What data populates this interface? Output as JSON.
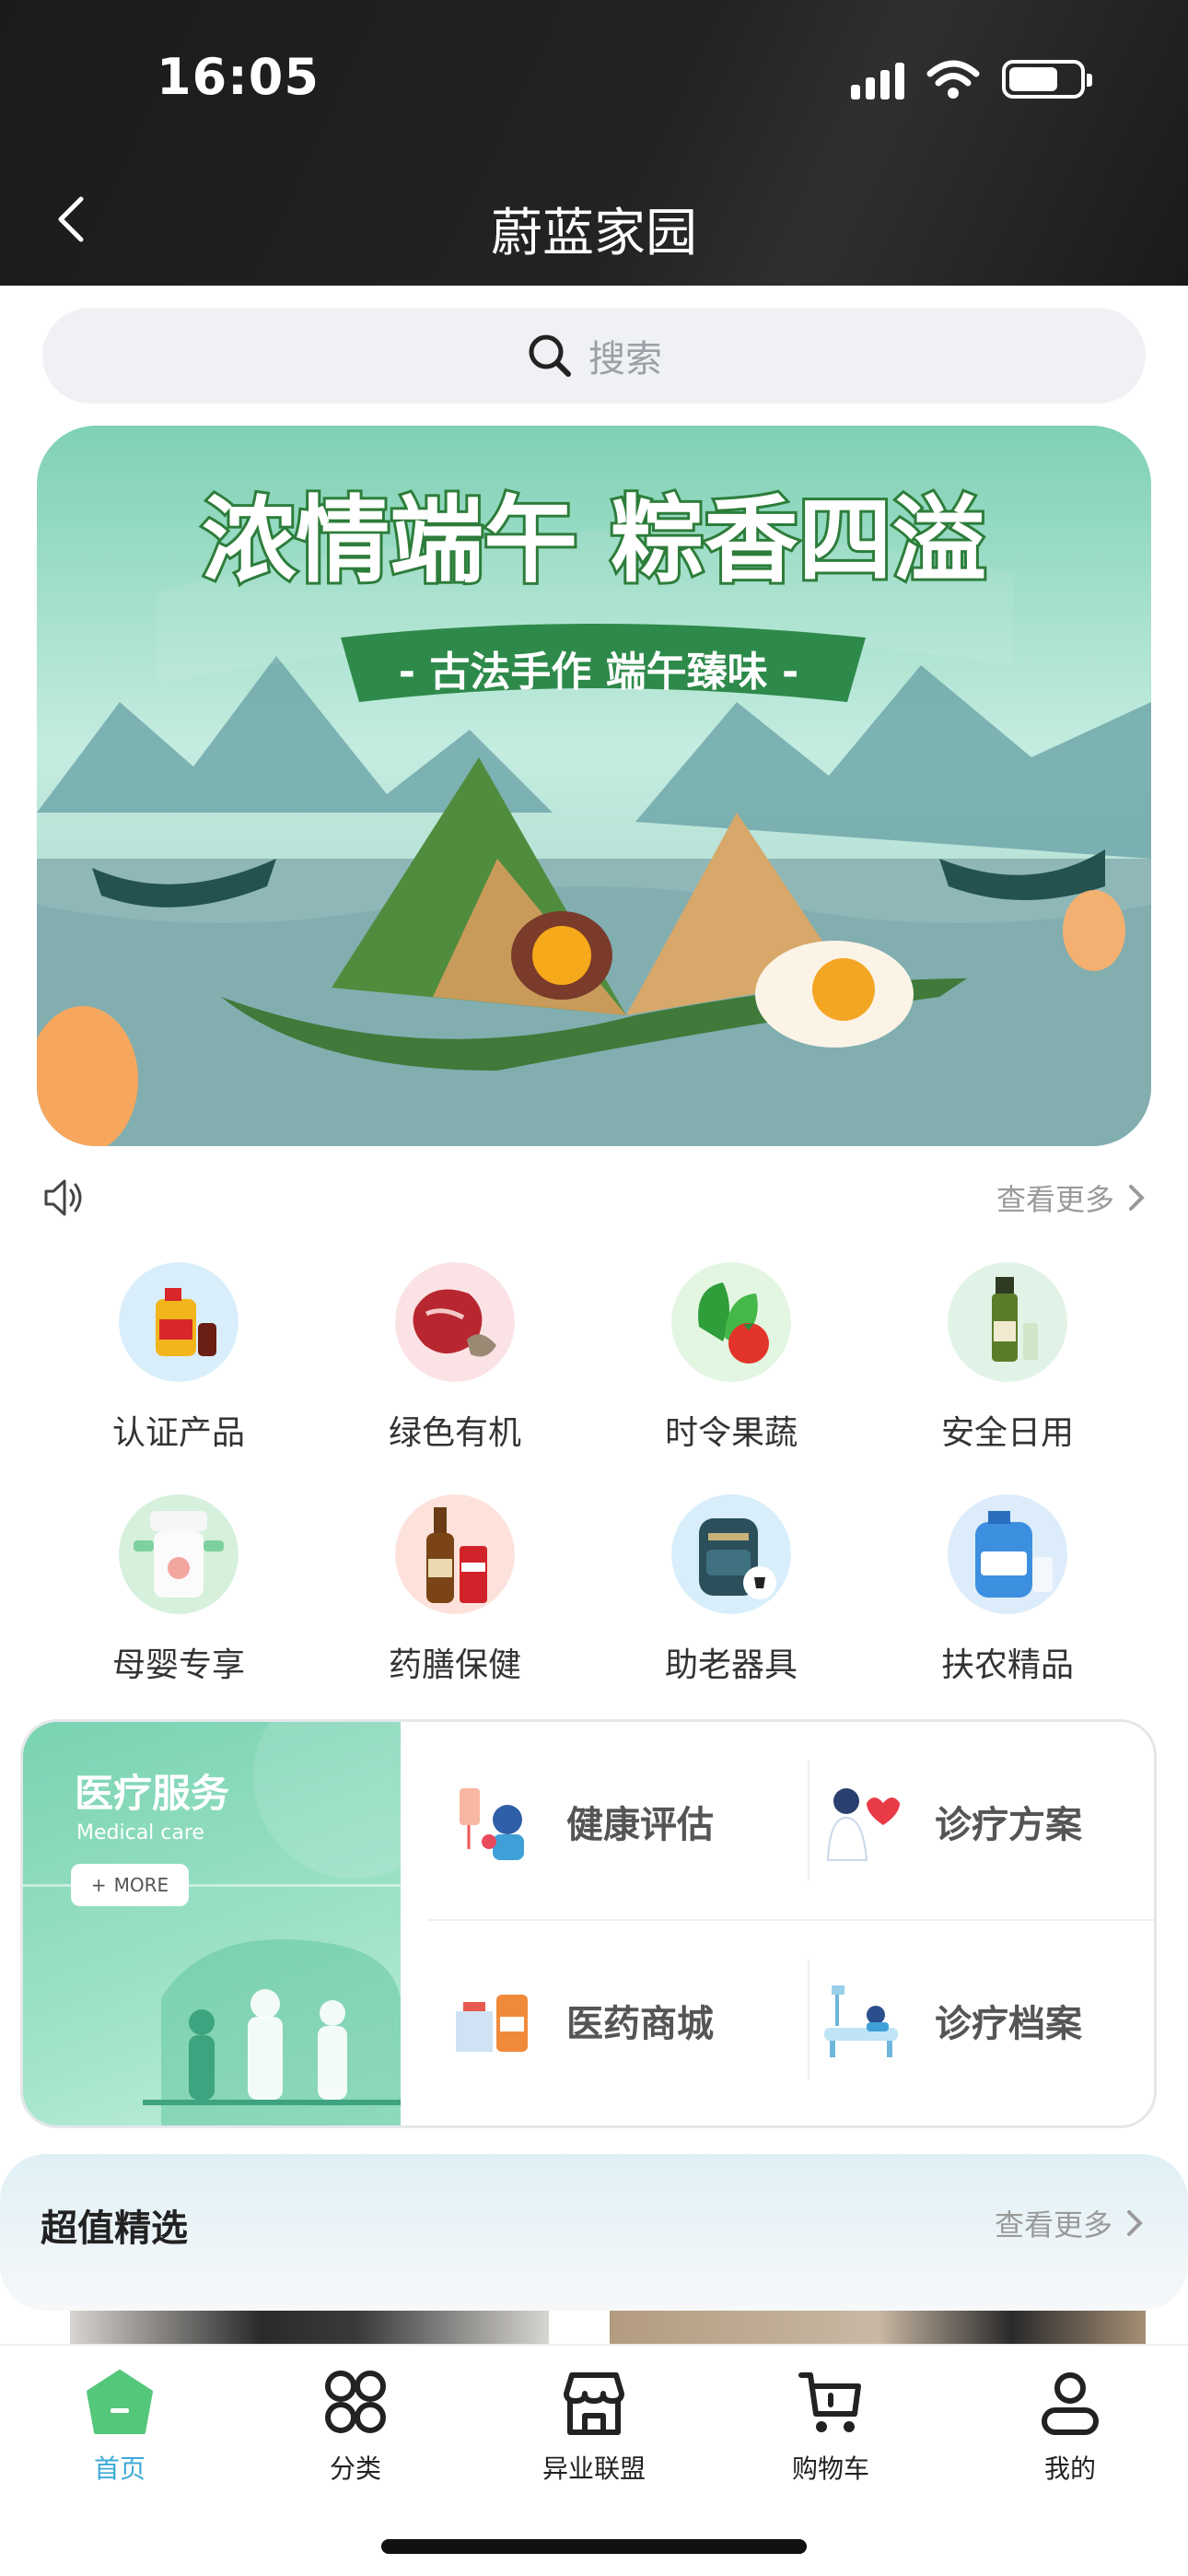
{
  "status_bar": {
    "time": "16:05"
  },
  "header": {
    "title": "蔚蓝家园"
  },
  "search": {
    "placeholder": "搜索"
  },
  "banner": {
    "headline": "浓情端午 粽香四溢",
    "tagline": "- 古法手作 端午臻味 -"
  },
  "notice": {
    "more_label": "查看更多"
  },
  "categories": [
    {
      "label": "认证产品",
      "icon": "cooking-oil-icon"
    },
    {
      "label": "绿色有机",
      "icon": "steak-icon"
    },
    {
      "label": "时令果蔬",
      "icon": "vegetables-icon"
    },
    {
      "label": "安全日用",
      "icon": "skincare-bottle-icon"
    },
    {
      "label": "母婴专享",
      "icon": "baby-bottle-icon"
    },
    {
      "label": "药膳保健",
      "icon": "beer-bottle-icon"
    },
    {
      "label": "助老器具",
      "icon": "backpack-icon"
    },
    {
      "label": "扶农精品",
      "icon": "detergent-icon"
    }
  ],
  "medical": {
    "title": "医疗服务",
    "subtitle": "Medical care",
    "more_label": "MORE",
    "items": [
      {
        "label": "健康评估",
        "icon": "health-assessment-icon"
      },
      {
        "label": "诊疗方案",
        "icon": "doctor-heart-icon"
      },
      {
        "label": "医药商城",
        "icon": "medicine-mall-icon"
      },
      {
        "label": "诊疗档案",
        "icon": "medical-record-icon"
      }
    ]
  },
  "value_pick": {
    "title": "超值精选",
    "more_label": "查看更多"
  },
  "bottom_nav": [
    {
      "label": "首页",
      "icon": "home-icon",
      "active": true
    },
    {
      "label": "分类",
      "icon": "category-grid-icon",
      "active": false
    },
    {
      "label": "异业联盟",
      "icon": "store-icon",
      "active": false
    },
    {
      "label": "购物车",
      "icon": "cart-icon",
      "active": false
    },
    {
      "label": "我的",
      "icon": "profile-icon",
      "active": false
    }
  ],
  "colors": {
    "accent_green": "#55c77a",
    "active_blue": "#3ea9d8",
    "medical_green": "#78d3b1"
  }
}
